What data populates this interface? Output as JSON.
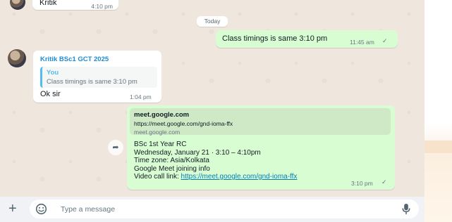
{
  "top_message": {
    "sender": "Kritik",
    "time": "4:10 pm"
  },
  "day_label": "Today",
  "outgoing_1": {
    "text": "Class timings is same 3:10 pm",
    "time": "11:45 am",
    "status": "✓"
  },
  "incoming_reply": {
    "sender": "Kritik BSc1 GCT 2025",
    "quote_author": "You",
    "quote_text": "Class timings is same 3:10 pm",
    "text": "Ok sir",
    "time": "1:04 pm"
  },
  "outgoing_2": {
    "preview_title": "meet.google.com",
    "preview_url": "https://meet.google.com/gnd-ioma-ffx",
    "preview_domain": "meet.google.com",
    "lines": [
      "BSc 1st Year RC",
      "Wednesday, January 21 · 3:10 – 4:10pm",
      "Time zone: Asia/Kolkata",
      "Google Meet joining info"
    ],
    "link_prefix": "Video call link: ",
    "link": "https://meet.google.com/gnd-ioma-ffx",
    "time": "3:10 pm",
    "status": "✓"
  },
  "forward_icon": "➦",
  "composer": {
    "placeholder": "Type a message",
    "plus": "+"
  },
  "icons": [
    "avatar",
    "forward-icon",
    "plus-icon",
    "sticker-icon",
    "mic-icon",
    "tick-icon"
  ],
  "colors": {
    "outgoing": "#d9fdd3",
    "incoming": "#ffffff",
    "sender": "#1d8bd1",
    "link": "#027eb5"
  }
}
